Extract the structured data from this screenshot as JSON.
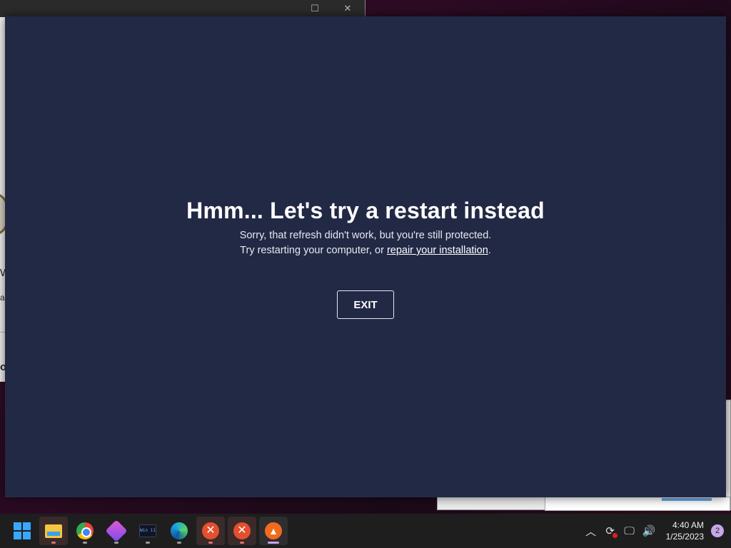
{
  "dialog": {
    "heading": "Hmm... Let's try a restart instead",
    "line1": "Sorry, that refresh didn't work, but you're still protected.",
    "line2_prefix": "Try restarting your computer, or ",
    "line2_link": "repair your installation",
    "line2_suffix": ".",
    "exit_label": "EXIT"
  },
  "background_fragments": {
    "frag1": "W",
    "frag2": "a",
    "frag3": "o"
  },
  "taskbar": {
    "apps": [
      {
        "name": "start",
        "icon": "windows-logo-icon"
      },
      {
        "name": "file-explorer",
        "icon": "folder-icon"
      },
      {
        "name": "chrome",
        "icon": "chrome-icon"
      },
      {
        "name": "gem-app",
        "icon": "gem-icon"
      },
      {
        "name": "terminal",
        "icon": "terminal-icon",
        "label": "Win 11"
      },
      {
        "name": "edge",
        "icon": "edge-icon"
      },
      {
        "name": "error-app-1",
        "icon": "error-x-icon"
      },
      {
        "name": "error-app-2",
        "icon": "error-x-icon"
      },
      {
        "name": "avast",
        "icon": "avast-icon"
      }
    ],
    "tray": {
      "time": "4:40 AM",
      "date": "1/25/2023",
      "notifications": "2"
    }
  },
  "colors": {
    "dialog_bg": "#222945",
    "accent_link": "#ffffff",
    "taskbar_bg": "#1e1e1e"
  }
}
